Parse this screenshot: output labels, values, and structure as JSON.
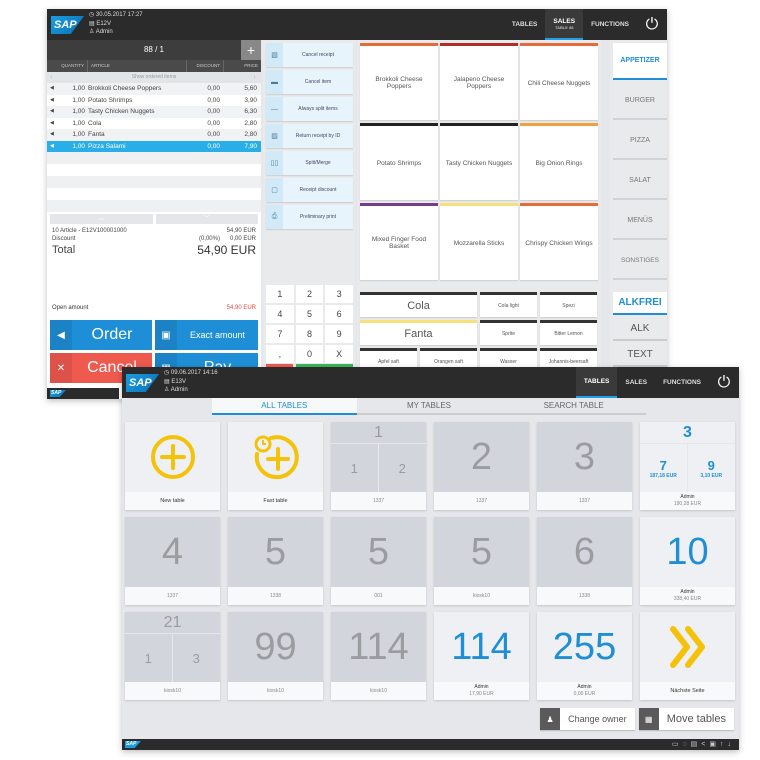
{
  "sales_window": {
    "header": {
      "datetime": "30.05.2017 17:27",
      "device": "E12V",
      "user": "Admin",
      "nav": [
        {
          "label": "TABLES",
          "sub": ""
        },
        {
          "label": "SALES",
          "sub": "TABLE 88",
          "active": true
        },
        {
          "label": "FUNCTIONS",
          "sub": ""
        }
      ],
      "power_icon": "power-icon"
    },
    "table_label": "88 / 1",
    "add_label": "+",
    "columns": [
      "QUANTITY",
      "ARTICLE",
      "DISCOUNT",
      "PRICE"
    ],
    "show_ordered": "Show ordered items",
    "items": [
      {
        "qty": "1,00",
        "article": "Brokkoli Cheese Poppers",
        "discount": "0,00",
        "price": "5,60"
      },
      {
        "qty": "1,00",
        "article": "Potato Shrimps",
        "discount": "0,00",
        "price": "3,90"
      },
      {
        "qty": "1,00",
        "article": "Tasty Chicken Nuggets",
        "discount": "0,00",
        "price": "6,30"
      },
      {
        "qty": "1,00",
        "article": "Cola",
        "discount": "0,00",
        "price": "2,80"
      },
      {
        "qty": "1,00",
        "article": "Fanta",
        "discount": "0,00",
        "price": "2,80"
      },
      {
        "qty": "1,00",
        "article": "Pizza Salami",
        "discount": "0,00",
        "price": "7,90",
        "selected": true
      }
    ],
    "summary": {
      "articles": "10 Article - E12V100001000",
      "articles_amount": "54,90 EUR",
      "discount_label": "Discount",
      "discount_pct": "(0,00%)",
      "discount_amount": "0,00 EUR",
      "total_label": "Total",
      "total_amount": "54,90 EUR",
      "open_label": "Open amount",
      "open_amount": "54,90 EUR"
    },
    "buttons": {
      "order": "Order",
      "exact": "Exact amount",
      "cancel": "Cancel",
      "pay": "Pay"
    },
    "functions": [
      "Cancel receipt",
      "Cancel item",
      "Always split items",
      "Return receipt by ID",
      "Split/Merge",
      "Receipt discount",
      "Preliminary print"
    ],
    "numpad": [
      "1",
      "2",
      "3",
      "4",
      "5",
      "6",
      "7",
      "8",
      "9",
      ",",
      "0",
      "X"
    ],
    "products": [
      {
        "name": "Brokkoli Cheese Poppers",
        "color": "#e86a3a"
      },
      {
        "name": "Jalapeno Cheese Poppers",
        "color": "#b52a2a"
      },
      {
        "name": "Chili Cheese Nuggets",
        "color": "#e86a3a"
      },
      {
        "name": "Potato Shrimps",
        "color": "#222222"
      },
      {
        "name": "Tasty Chicken Nuggets",
        "color": "#222222"
      },
      {
        "name": "Big Onion Rings",
        "color": "#f0a040"
      },
      {
        "name": "Mixed Finger Food Basket",
        "color": "#7a3a8a"
      },
      {
        "name": "Mozzarella Sticks",
        "color": "#f5e07a"
      },
      {
        "name": "Chrispy Chicken Wings",
        "color": "#e86a3a"
      }
    ],
    "drinks": [
      "Cola",
      "Cola light",
      "Spezi",
      "Fanta",
      "Sprite",
      "Bitter Lemon",
      "Apfel saft",
      "Orangen saft",
      "Wasser",
      "Johannis-beersaft"
    ],
    "categories": [
      "APPETIZER",
      "BURGER",
      "PIZZA",
      "SALAT",
      "MENÜS",
      "SONSTIGES"
    ],
    "categories2": [
      "ALKFREI",
      "ALK",
      "TEXT"
    ]
  },
  "tables_window": {
    "header": {
      "datetime": "09.06.2017 14:16",
      "device": "E13V",
      "user": "Admin",
      "nav": [
        {
          "label": "TABLES",
          "active": true
        },
        {
          "label": "SALES"
        },
        {
          "label": "FUNCTIONS"
        }
      ]
    },
    "tabs": [
      "ALL TABLES",
      "MY TABLES",
      "SEARCH TABLE"
    ],
    "tiles": [
      {
        "label": "New table",
        "kind": "new"
      },
      {
        "label": "Fast table",
        "kind": "fast"
      },
      {
        "kind": "split",
        "top": "1",
        "left": "1",
        "right": "2",
        "foot": "1337"
      },
      {
        "kind": "free",
        "num": "2",
        "foot": "1337"
      },
      {
        "kind": "free",
        "num": "3",
        "foot": "1337"
      },
      {
        "kind": "occsplit",
        "top": "3",
        "left": "7",
        "left_amt": "187,18 EUR",
        "right": "9",
        "right_amt": "3,10 EUR",
        "owner": "Admin",
        "amount": "190,28 EUR"
      },
      {
        "kind": "free",
        "num": "4",
        "foot": "1337"
      },
      {
        "kind": "free",
        "num": "5",
        "foot": "1338"
      },
      {
        "kind": "free",
        "num": "5",
        "foot": "001"
      },
      {
        "kind": "free",
        "num": "5",
        "foot": "kiosk10"
      },
      {
        "kind": "free",
        "num": "6",
        "foot": "1338"
      },
      {
        "kind": "occ",
        "num": "10",
        "owner": "Admin",
        "amount": "338,40 EUR"
      },
      {
        "kind": "split",
        "top": "21",
        "left": "1",
        "right": "3",
        "foot": "kiosk10"
      },
      {
        "kind": "free",
        "num": "99",
        "foot": "kiosk10"
      },
      {
        "kind": "free",
        "num": "114",
        "foot": "kiosk10"
      },
      {
        "kind": "occ",
        "num": "114",
        "owner": "Admin",
        "amount": "17,90 EUR"
      },
      {
        "kind": "occ",
        "num": "255",
        "owner": "Admin",
        "amount": "0,00 EUR"
      },
      {
        "kind": "next",
        "label": "Nächste Seite"
      }
    ],
    "actions": {
      "change_owner": "Change owner",
      "move_tables": "Move tables"
    },
    "accent": "#1e8fd6",
    "yellow": "#f5c20a"
  }
}
